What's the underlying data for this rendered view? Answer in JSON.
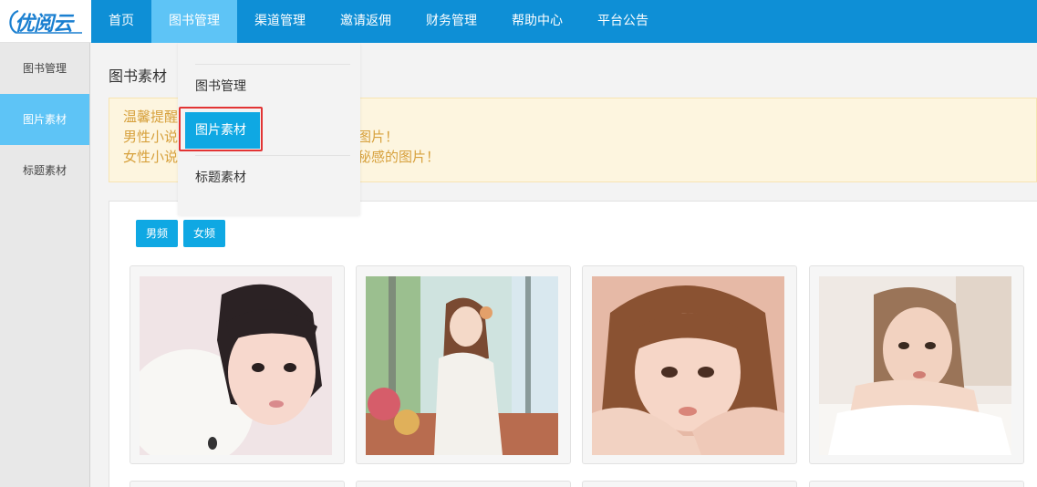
{
  "brand": {
    "logo_text": "优阅云",
    "accent": "#0e8fd6",
    "highlight": "#5ec4f6"
  },
  "topnav": {
    "items": [
      {
        "label": "首页"
      },
      {
        "label": "图书管理",
        "active": true
      },
      {
        "label": "渠道管理"
      },
      {
        "label": "邀请返佣"
      },
      {
        "label": "财务管理"
      },
      {
        "label": "帮助中心"
      },
      {
        "label": "平台公告"
      }
    ]
  },
  "sidebar": {
    "items": [
      {
        "label": "图书管理"
      },
      {
        "label": "图片素材",
        "active": true
      },
      {
        "label": "标题素材"
      }
    ]
  },
  "dropdown": {
    "items": [
      {
        "label": "图书管理"
      },
      {
        "label": "图片素材",
        "active": true
      },
      {
        "label": "标题素材"
      }
    ]
  },
  "main": {
    "title": "图书素材",
    "notice": {
      "lines": [
        "温馨提醒",
        "男性小说",
        "女性小说"
      ],
      "tail_line_2": "图片！",
      "tail_line_3": "秘感的图片！"
    },
    "tabs": [
      {
        "label": "男频"
      },
      {
        "label": "女频"
      }
    ],
    "images": [
      {
        "name": "portrait-1"
      },
      {
        "name": "portrait-2"
      },
      {
        "name": "portrait-3"
      },
      {
        "name": "portrait-4"
      }
    ]
  }
}
